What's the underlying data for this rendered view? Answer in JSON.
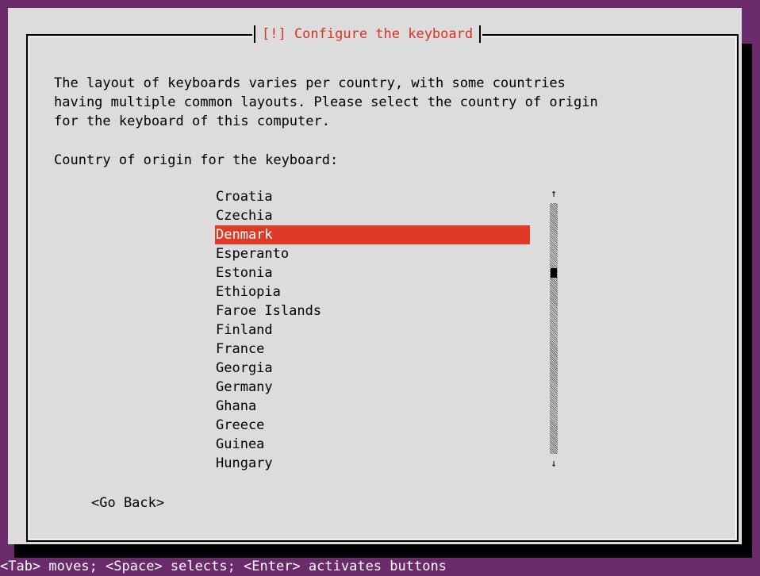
{
  "dialog": {
    "title": "[!] Configure the keyboard",
    "description": "The layout of keyboards varies per country, with some countries\nhaving multiple common layouts. Please select the country of origin\nfor the keyboard of this computer.",
    "prompt": "Country of origin for the keyboard:",
    "options": [
      "Croatia",
      "Czechia",
      "Denmark",
      "Esperanto",
      "Estonia",
      "Ethiopia",
      "Faroe Islands",
      "Finland",
      "France",
      "Georgia",
      "Germany",
      "Ghana",
      "Greece",
      "Guinea",
      "Hungary"
    ],
    "selected": "Denmark",
    "scroll_up_glyph": "↑",
    "scroll_down_glyph": "↓",
    "go_back_label": "<Go Back>"
  },
  "status_bar": {
    "text": "<Tab> moves; <Space> selects; <Enter> activates buttons"
  },
  "colors": {
    "background": "#6b2a6b",
    "dialog": "#dcdcdc",
    "accent": "#dd3a27",
    "title": "#d9321f"
  }
}
